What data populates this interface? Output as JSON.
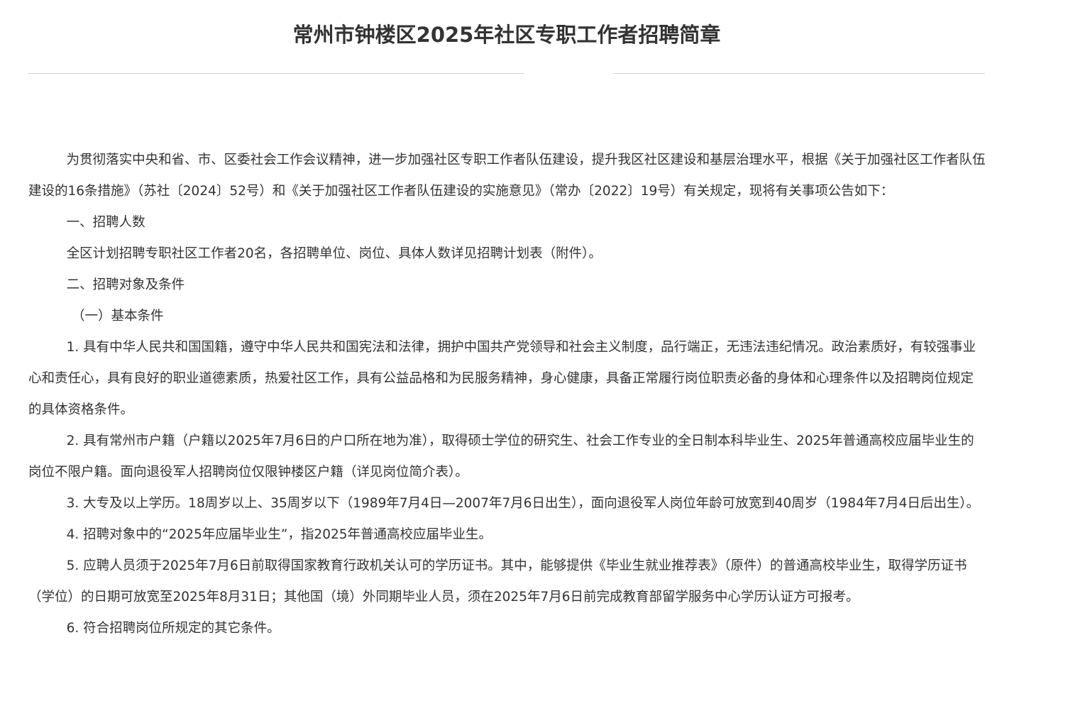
{
  "document": {
    "title": "常州市钟楼区2025年社区专职工作者招聘简章",
    "paragraphs": [
      "为贯彻落实中央和省、市、区委社会工作会议精神，进一步加强社区专职工作者队伍建设，提升我区社区建设和基层治理水平，根据《关于加强社区工作者队伍建设的16条措施》（苏社〔2024〕52号）和《关于加强社区工作者队伍建设的实施意见》（常办〔2022〕19号）有关规定，现将有关事项公告如下：",
      "一、招聘人数",
      "全区计划招聘专职社区工作者20名，各招聘单位、岗位、具体人数详见招聘计划表（附件）。",
      "二、招聘对象及条件",
      "（一）基本条件",
      "1. 具有中华人民共和国国籍，遵守中华人民共和国宪法和法律，拥护中国共产党领导和社会主义制度，品行端正，无违法违纪情况。政治素质好，有较强事业心和责任心，具有良好的职业道德素质，热爱社区工作，具有公益品格和为民服务精神，身心健康，具备正常履行岗位职责必备的身体和心理条件以及招聘岗位规定的具体资格条件。",
      "2. 具有常州市户籍（户籍以2025年7月6日的户口所在地为准），取得硕士学位的研究生、社会工作专业的全日制本科毕业生、2025年普通高校应届毕业生的岗位不限户籍。面向退役军人招聘岗位仅限钟楼区户籍（详见岗位简介表）。",
      "3. 大专及以上学历。18周岁以上、35周岁以下（1989年7月4日—2007年7月6日出生），面向退役军人岗位年龄可放宽到40周岁（1984年7月4日后出生）。",
      "4. 招聘对象中的“2025年应届毕业生”，指2025年普通高校应届毕业生。",
      "5. 应聘人员须于2025年7月6日前取得国家教育行政机关认可的学历证书。其中，能够提供《毕业生就业推荐表》（原件）的普通高校毕业生，取得学历证书（学位）的日期可放宽至2025年8月31日；其他国（境）外同期毕业人员，须在2025年7月6日前完成教育部留学服务中心学历认证方可报考。",
      "6. 符合招聘岗位所规定的其它条件。"
    ]
  }
}
